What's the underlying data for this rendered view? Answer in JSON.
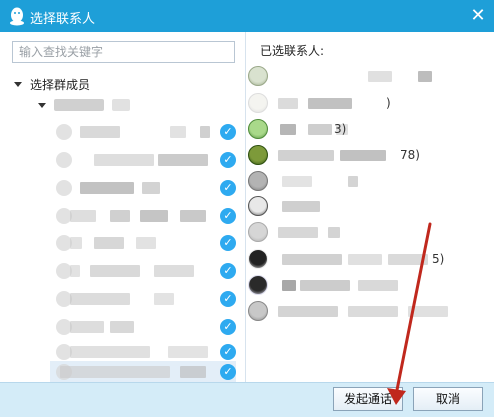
{
  "window": {
    "title": "选择联系人",
    "close_glyph": "✕"
  },
  "search": {
    "placeholder": "输入查找关键字"
  },
  "tree": {
    "group_label": "选择群成员",
    "members": [
      {
        "selected": false
      },
      {
        "selected": false
      },
      {
        "selected": false
      },
      {
        "selected": false
      },
      {
        "selected": false
      },
      {
        "selected": false
      },
      {
        "selected": false
      },
      {
        "selected": false
      },
      {
        "selected": false
      },
      {
        "selected": false
      },
      {
        "selected": true
      }
    ]
  },
  "selected_panel": {
    "title": "已选联系人:",
    "contacts": [
      {
        "suffix": ""
      },
      {
        "suffix": ")"
      },
      {
        "suffix": "3)"
      },
      {
        "suffix": "78)"
      },
      {
        "suffix": ""
      },
      {
        "suffix": ""
      },
      {
        "suffix": ""
      },
      {
        "suffix": "5)"
      },
      {
        "suffix": ""
      },
      {
        "suffix": ""
      }
    ]
  },
  "buttons": {
    "call": "发起通话",
    "cancel": "取消"
  },
  "colors": {
    "titlebar": "#1e9fd8",
    "check": "#2eaaf0",
    "footer": "#d4ecf8",
    "arrow": "#c0281d"
  },
  "icons": {
    "app": "qq-penguin-icon",
    "close": "close-icon",
    "check": "checkmark-icon",
    "expand": "triangle-down-icon"
  }
}
